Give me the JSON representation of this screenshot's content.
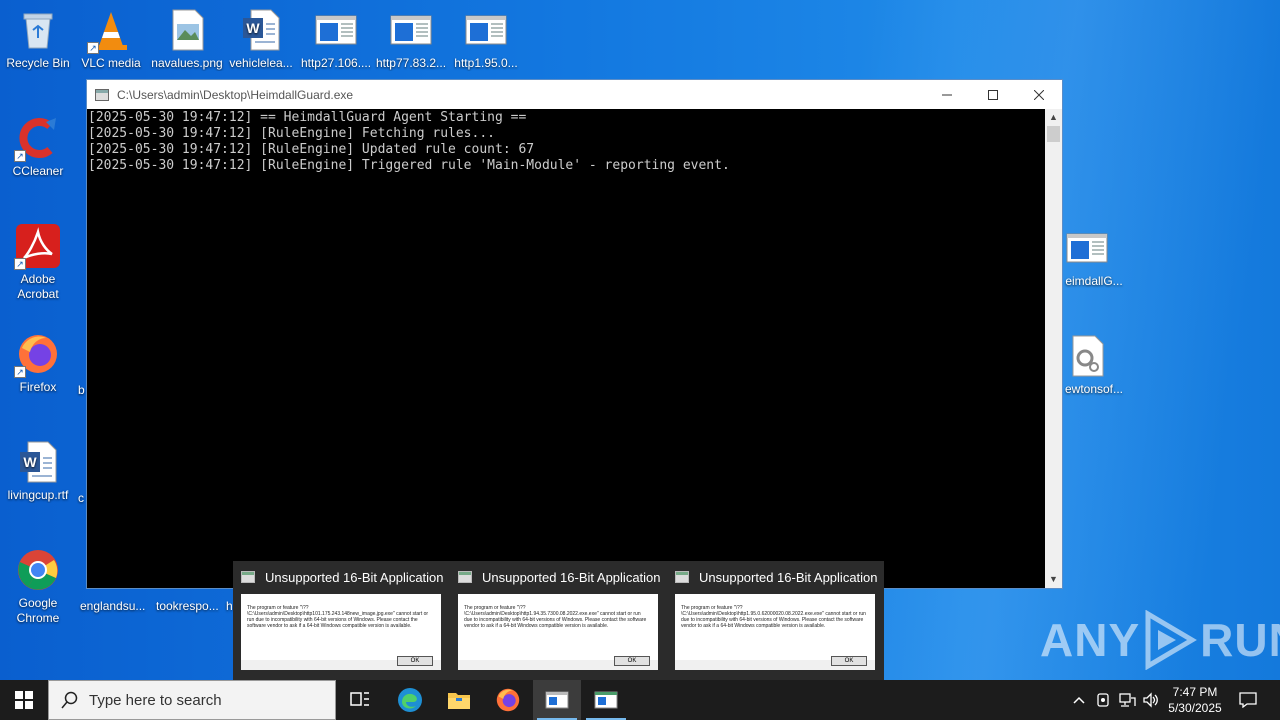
{
  "desktop": {
    "icons_top": [
      {
        "label": "Recycle Bin",
        "icon": "recycle-bin-icon"
      },
      {
        "label": "VLC media",
        "icon": "vlc-icon"
      },
      {
        "label": "navalues.png",
        "icon": "image-file-icon"
      },
      {
        "label": "vehiclelea...",
        "icon": "word-document-icon"
      },
      {
        "label": "http27.106....",
        "icon": "executable-window-icon"
      },
      {
        "label": "http77.83.2...",
        "icon": "executable-window-icon"
      },
      {
        "label": "http1.95.0...",
        "icon": "executable-window-icon"
      }
    ],
    "icons_left": [
      {
        "label": "CCleaner",
        "icon": "ccleaner-icon"
      },
      {
        "label": "Adobe Acrobat",
        "icon": "adobe-acrobat-icon"
      },
      {
        "label": "Firefox",
        "icon": "firefox-icon"
      },
      {
        "label": "livingcup.rtf",
        "icon": "word-document-icon"
      },
      {
        "label": "Google Chrome",
        "icon": "chrome-icon"
      }
    ],
    "icons_right": [
      {
        "label": "eimdallG...",
        "icon": "executable-window-icon"
      },
      {
        "label": "ewtonsof...",
        "icon": "settings-file-icon"
      }
    ],
    "partial_labels": [
      "b",
      "c",
      "englandsu...",
      "tookrespo...",
      "h"
    ]
  },
  "console": {
    "title": "C:\\Users\\admin\\Desktop\\HeimdallGuard.exe",
    "lines": [
      "[2025-05-30 19:47:12] == HeimdallGuard Agent Starting ==",
      "[2025-05-30 19:47:12] [RuleEngine] Fetching rules...",
      "[2025-05-30 19:47:12] [RuleEngine] Updated rule count: 67",
      "[2025-05-30 19:47:12] [RuleEngine] Triggered rule 'Main-Module' - reporting event."
    ]
  },
  "previews": [
    {
      "title": "Unsupported 16-Bit Application",
      "message": "The program or feature \"\\??\\C:\\Users\\admin\\Desktop\\http101.175.243.148new_image.jpg.exe\" cannot start or run due to incompatibility with 64-bit versions of Windows. Please contact the software vendor to ask if a 64-bit Windows compatible version is available.",
      "ok": "OK"
    },
    {
      "title": "Unsupported 16-Bit Application",
      "message": "The program or feature \"\\??\\C:\\Users\\admin\\Desktop\\http1.94.35.7300.08.2022.exe.exe\" cannot start or run due to incompatibility with 64-bit versions of Windows. Please contact the software vendor to ask if a 64-bit Windows compatible version is available.",
      "ok": "OK"
    },
    {
      "title": "Unsupported 16-Bit Application",
      "message": "The program or feature \"\\??\\C:\\Users\\admin\\Desktop\\http1.95.0.62000020.08.2022.exe.exe\" cannot start or run due to incompatibility with 64-bit versions of Windows. Please contact the software vendor to ask if a 64-bit Windows compatible version is available.",
      "ok": "OK"
    }
  ],
  "watermark": {
    "left": "ANY",
    "right": "RUN"
  },
  "taskbar": {
    "search_placeholder": "Type here to search",
    "time": "7:47 PM",
    "date": "5/30/2025"
  }
}
